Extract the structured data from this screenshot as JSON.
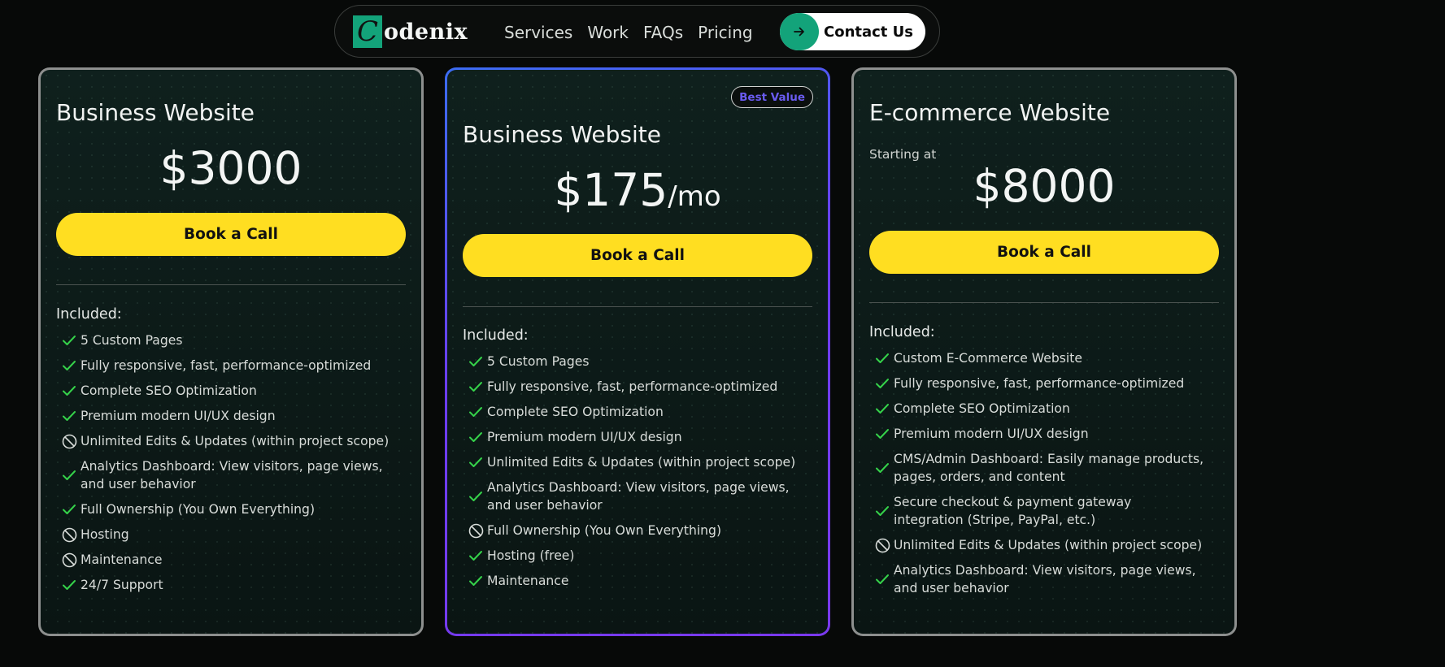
{
  "nav": {
    "logo_letter": "C",
    "logo_rest": "odenix",
    "links": [
      "Services",
      "Work",
      "FAQs",
      "Pricing"
    ],
    "contact_label": "Contact Us"
  },
  "colors": {
    "accent_green": "#13a37a",
    "cta_yellow": "#ffde21",
    "check_green": "#35d24a",
    "highlight_border": "#7a39ee"
  },
  "plans": [
    {
      "title": "Business Website",
      "price": "$3000",
      "cta": "Book a Call",
      "included_label": "Included:",
      "features": [
        {
          "text": "5 Custom Pages",
          "icon": "check-icon"
        },
        {
          "text": "Fully responsive, fast, performance-optimized",
          "icon": "check-icon"
        },
        {
          "text": "Complete SEO Optimization",
          "icon": "check-icon"
        },
        {
          "text": "Premium modern UI/UX design",
          "icon": "check-icon"
        },
        {
          "text": "Unlimited Edits & Updates (within project scope)",
          "icon": "not-included-icon"
        },
        {
          "text": "Analytics Dashboard: View visitors, page views, and user behavior",
          "icon": "check-icon"
        },
        {
          "text": "Full Ownership (You Own Everything)",
          "icon": "check-icon"
        },
        {
          "text": "Hosting",
          "icon": "not-included-icon"
        },
        {
          "text": "Maintenance",
          "icon": "not-included-icon"
        },
        {
          "text": "24/7 Support",
          "icon": "check-icon"
        }
      ]
    },
    {
      "badge": "Best Value",
      "title": "Business Website",
      "price": "$175",
      "price_suffix": "/mo",
      "cta": "Book a Call",
      "included_label": "Included:",
      "features": [
        {
          "text": "5 Custom Pages",
          "icon": "check-icon"
        },
        {
          "text": "Fully responsive, fast, performance-optimized",
          "icon": "check-icon"
        },
        {
          "text": "Complete SEO Optimization",
          "icon": "check-icon"
        },
        {
          "text": "Premium modern UI/UX design",
          "icon": "check-icon"
        },
        {
          "text": "Unlimited Edits & Updates (within project scope)",
          "icon": "check-icon"
        },
        {
          "text": "Analytics Dashboard: View visitors, page views, and user behavior",
          "icon": "check-icon"
        },
        {
          "text": "Full Ownership (You Own Everything)",
          "icon": "not-included-icon"
        },
        {
          "text": "Hosting (free)",
          "icon": "check-icon"
        },
        {
          "text": "Maintenance",
          "icon": "check-icon"
        }
      ]
    },
    {
      "title": "E-commerce Website",
      "starting_label": "Starting at",
      "price": "$8000",
      "cta": "Book a Call",
      "included_label": "Included:",
      "features": [
        {
          "text": "Custom E-Commerce Website",
          "icon": "check-icon"
        },
        {
          "text": "Fully responsive, fast, performance-optimized",
          "icon": "check-icon"
        },
        {
          "text": "Complete SEO Optimization",
          "icon": "check-icon"
        },
        {
          "text": "Premium modern UI/UX design",
          "icon": "check-icon"
        },
        {
          "text": "CMS/Admin Dashboard: Easily manage products, pages, orders, and content",
          "icon": "check-icon"
        },
        {
          "text": "Secure checkout & payment gateway integration (Stripe, PayPal, etc.)",
          "icon": "check-icon"
        },
        {
          "text": "Unlimited Edits & Updates (within project scope)",
          "icon": "not-included-icon"
        },
        {
          "text": "Analytics Dashboard: View visitors, page views, and user behavior",
          "icon": "check-icon"
        }
      ]
    }
  ]
}
